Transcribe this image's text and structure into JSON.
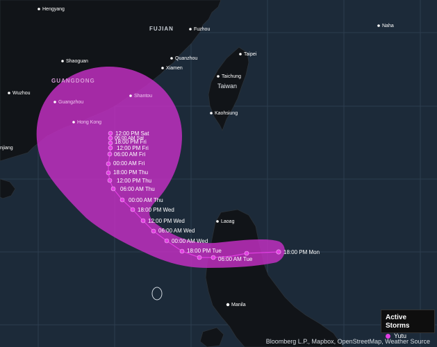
{
  "colors": {
    "sea": "#1c2a39",
    "land": "#111418",
    "grid": "#2d3d4e",
    "cone": "#c42fc4",
    "track": "#e23fe2",
    "city_label": "#ffffff",
    "region_label": "#c9cfd6"
  },
  "regions": {
    "fujian": "FUJIAN",
    "guangdong": "GUANGDONG",
    "taiwan": "Taiwan"
  },
  "cities": {
    "hengyang": "Hengyang",
    "fuzhou": "Fuzhou",
    "naha": "Naha",
    "shaoguan": "Shaoguan",
    "quanzhou": "Quanzhou",
    "taipei": "Taipei",
    "xiamen": "Xiamen",
    "taichung": "Taichung",
    "wuzhou": "Wuzhou",
    "shantou": "Shantou",
    "guangzhou": "Guangzhou",
    "kaohsiung": "Kaohsiung",
    "hong_kong": "Hong Kong",
    "zhanjiang_partial": "njiang",
    "laoag": "Laoag",
    "manila": "Manila"
  },
  "forecast_labels": {
    "mon_18": "18:00 PM Mon",
    "tue_06": "06:00 AM Tue",
    "tue_18": "18:00 PM Tue",
    "wed_00": "00:00 AM Wed",
    "wed_06": "06:00 AM Wed",
    "wed_12": "12:00 PM Wed",
    "wed_18": "18:00 PM Wed",
    "thu_00": "00:00 AM Thu",
    "thu_06": "06:00 AM Thu",
    "thu_12": "12:00 PM Thu",
    "thu_18": "18:00 PM Thu",
    "fri_00": "00:00 AM Fri",
    "fri_06": "06:00 AM Fri",
    "fri_12": "12:00 PM Fri",
    "fri_18": "18:00 PM Fri",
    "sat_06": "06:00 AM Sat",
    "sat_12": "12:00 PM Sat"
  },
  "legend": {
    "title": "Active Storms",
    "storm_name": "Yutu"
  },
  "attribution": "Bloomberg L.P., Mapbox, OpenStreetMap, Weather Source"
}
